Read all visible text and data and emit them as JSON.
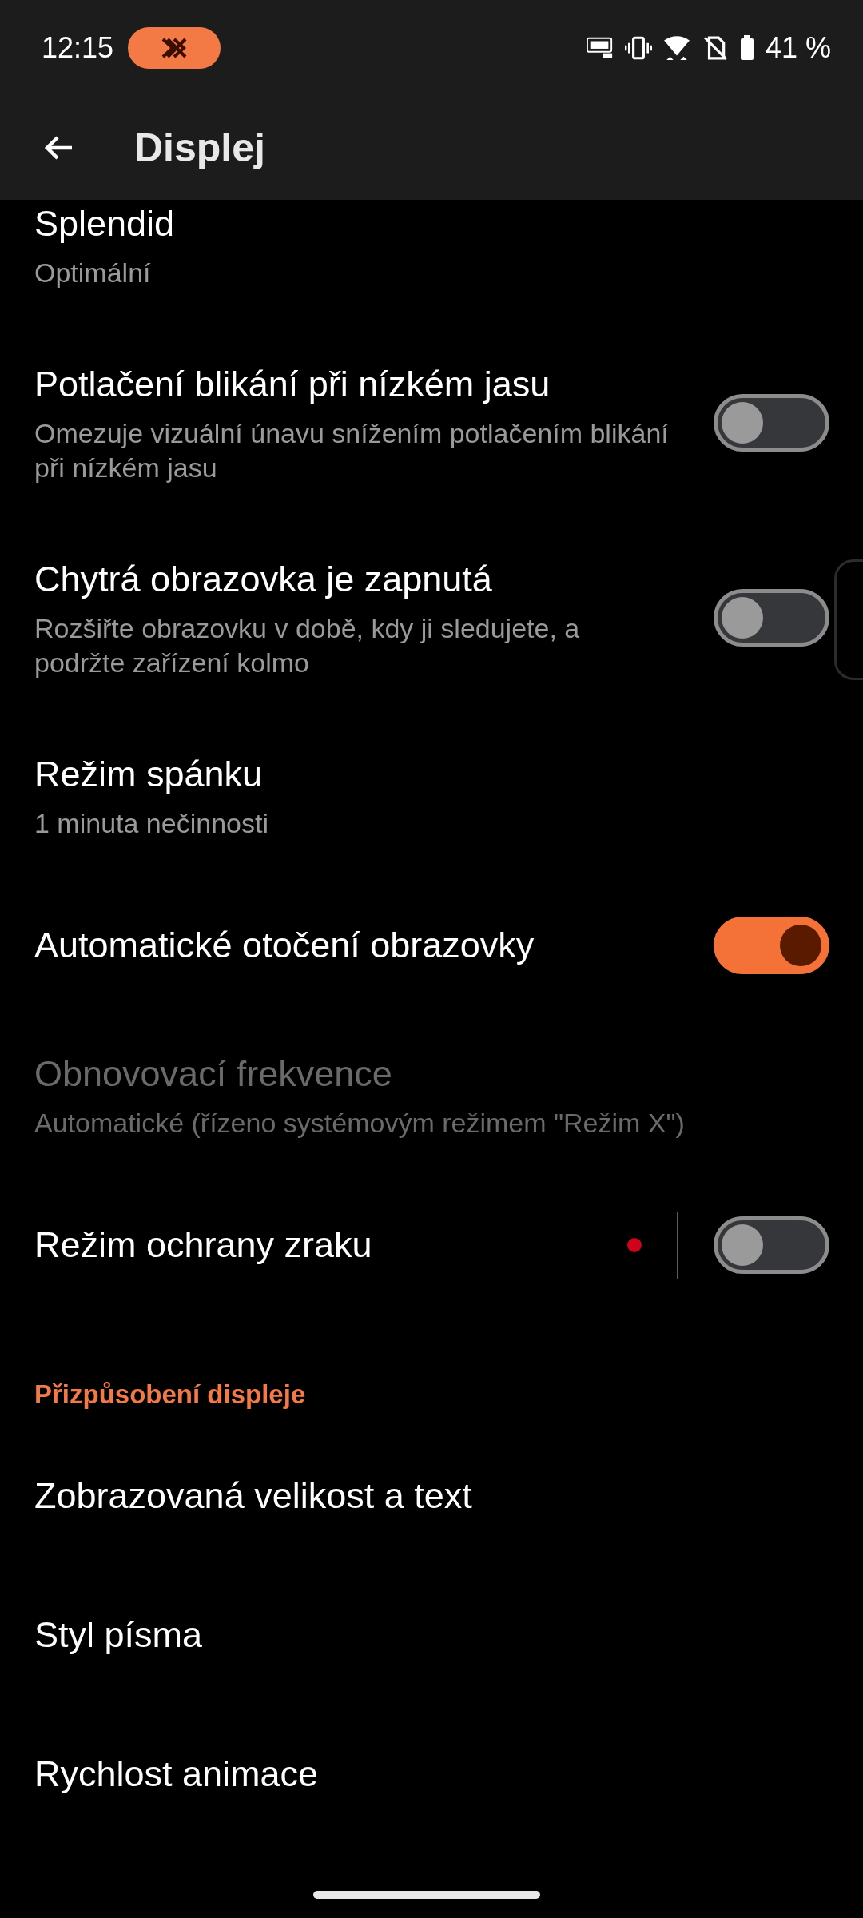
{
  "status_bar": {
    "time": "12:15",
    "battery_percent": "41 %"
  },
  "app_bar": {
    "title": "Displej"
  },
  "sections": [
    {
      "items": [
        {
          "title": "Splendid",
          "subtitle": "Optimální",
          "disabled": false,
          "badge": false
        },
        {
          "title": "Potlačení blikání při nízkém jasu",
          "subtitle": "Omezuje vizuální únavu snížením potlačením blikání při nízkém jasu",
          "toggle": {
            "on": false
          },
          "disabled": false,
          "badge": false
        },
        {
          "title": "Chytrá obrazovka je zapnutá",
          "subtitle": "Rozšiřte obrazovku v době, kdy ji sledujete, a podržte zařízení kolmo",
          "toggle": {
            "on": false
          },
          "disabled": false,
          "badge": false
        },
        {
          "title": "Režim spánku",
          "subtitle": "1 minuta nečinnosti",
          "disabled": false,
          "badge": false
        },
        {
          "title": "Automatické otočení obrazovky",
          "toggle": {
            "on": true
          },
          "disabled": false,
          "badge": false
        },
        {
          "title": "Obnovovací frekvence",
          "subtitle": "Automatické (řízeno systémovým režimem \"Režim X\")",
          "disabled": true,
          "badge": false
        },
        {
          "title": "Režim ochrany zraku",
          "toggle": {
            "on": false
          },
          "disabled": false,
          "badge": true
        }
      ]
    },
    {
      "header": "Přizpůsobení displeje",
      "items": [
        {
          "title": "Zobrazovaná velikost a text",
          "disabled": false,
          "badge": false
        },
        {
          "title": "Styl písma",
          "disabled": false,
          "badge": false
        },
        {
          "title": "Rychlost animace",
          "disabled": false,
          "badge": false
        }
      ]
    }
  ]
}
